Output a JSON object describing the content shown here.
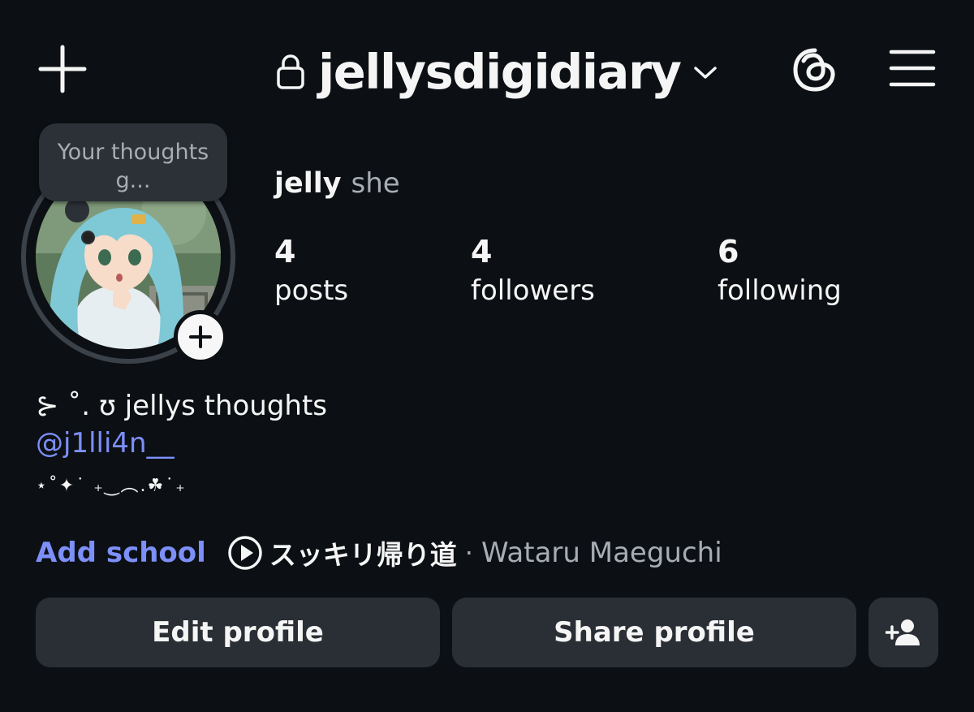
{
  "header": {
    "username": "jellysdigidiary",
    "icons": {
      "create": "plus-icon",
      "private": "lock-icon",
      "switch_account": "chevron-down-icon",
      "threads": "threads-icon",
      "menu": "hamburger-menu-icon"
    }
  },
  "note": {
    "text": "Your thoughts g..."
  },
  "profile": {
    "display_name": "jelly",
    "pronouns": "she"
  },
  "stats": [
    {
      "value": "4",
      "label": "posts"
    },
    {
      "value": "4",
      "label": "followers"
    },
    {
      "value": "6",
      "label": "following"
    }
  ],
  "bio": {
    "line1": "⊱ ˚. ʊ jellys thoughts",
    "mention": "@j1lli4n__",
    "line3": "⋆˚✦˙ ₊‿︵.☘˙₊"
  },
  "music": {
    "add_school_label": "Add school",
    "song_title": "スッキリ帰り道",
    "separator": "·",
    "artist": "Wataru Maeguchi"
  },
  "actions": {
    "edit_label": "Edit profile",
    "share_label": "Share profile"
  },
  "colors": {
    "background": "#0c1014",
    "link": "#7d8ff8",
    "button": "#2a2f35",
    "secondary_text": "#a8adb3"
  }
}
